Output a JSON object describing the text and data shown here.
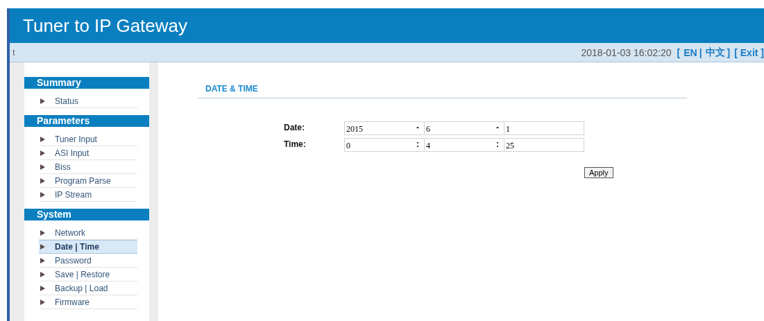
{
  "header": {
    "title": "Tuner to IP Gateway"
  },
  "subbar": {
    "left_text": "t",
    "datetime": "2018-01-03 16:02:20",
    "language": {
      "open": "[",
      "options": [
        {
          "label": "EN"
        },
        {
          "label": "中文"
        }
      ],
      "divider": "|",
      "close": "]"
    },
    "exit": "[ Exit ]"
  },
  "sidebar": {
    "sections": [
      {
        "title": "Summary",
        "items": [
          {
            "label": "Status",
            "selected": false
          }
        ]
      },
      {
        "title": "Parameters",
        "items": [
          {
            "label": "Tuner Input",
            "selected": false
          },
          {
            "label": "ASI Input",
            "selected": false
          },
          {
            "label": "Biss",
            "selected": false
          },
          {
            "label": "Program Parse",
            "selected": false
          },
          {
            "label": "IP Stream",
            "selected": false
          }
        ]
      },
      {
        "title": "System",
        "items": [
          {
            "label": "Network",
            "selected": false
          },
          {
            "label": "Date | Time",
            "selected": true
          },
          {
            "label": "Password",
            "selected": false
          },
          {
            "label": "Save | Restore",
            "selected": false
          },
          {
            "label": "Backup | Load",
            "selected": false
          },
          {
            "label": "Firmware",
            "selected": false
          }
        ]
      }
    ]
  },
  "main": {
    "heading": "DATE & TIME",
    "rows": [
      {
        "label": "Date:",
        "fields": [
          {
            "value": "2015",
            "separator": "-"
          },
          {
            "value": "6",
            "separator": "-"
          },
          {
            "value": "1"
          }
        ]
      },
      {
        "label": "Time:",
        "fields": [
          {
            "value": "0",
            "separator": ":"
          },
          {
            "value": "4",
            "separator": ":"
          },
          {
            "value": "25"
          }
        ]
      }
    ],
    "button": "Apply"
  }
}
